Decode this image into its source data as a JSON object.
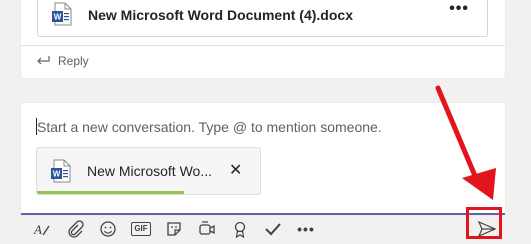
{
  "message": {
    "file_name": "New Microsoft Word Document (4).docx",
    "more_label": "•••",
    "reply_label": "Reply"
  },
  "compose": {
    "placeholder": "Start a new conversation. Type @ to mention someone.",
    "attachment_name": "New Microsoft Wo...",
    "attachment_close": "✕",
    "upload_progress": 0.66
  },
  "toolbar": {
    "icons": [
      "format-icon",
      "attach-icon",
      "emoji-icon",
      "gif-icon",
      "sticker-icon",
      "meet-now-icon",
      "praise-icon",
      "approvals-icon",
      "more-options-icon",
      "send-icon"
    ],
    "gif_label": "GIF",
    "more_label": "•••"
  },
  "colors": {
    "accent": "#6264a7",
    "highlight_red": "#e3141c",
    "progress_green": "#92c353",
    "word_blue": "#2b579a"
  }
}
